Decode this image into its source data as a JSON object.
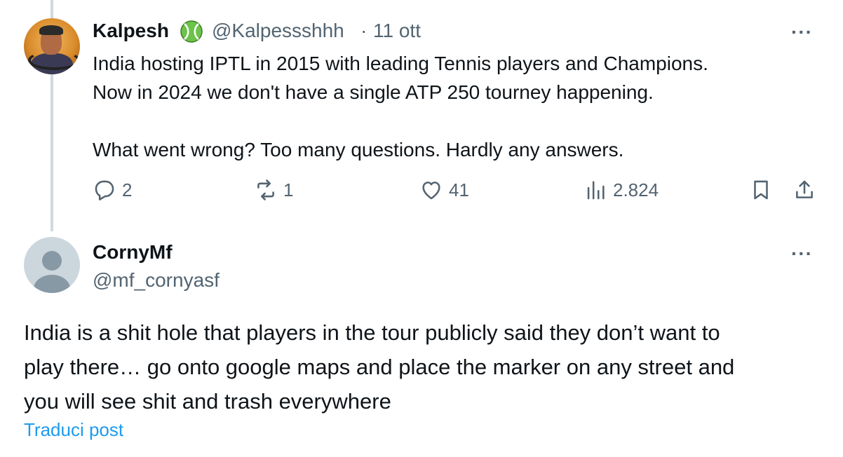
{
  "tweet": {
    "author_name": "Kalpesh",
    "handle": "@Kalpessshhh",
    "separator": "·",
    "date": "11 ott",
    "more_label": "···",
    "lines": [
      "India hosting IPTL in 2015 with leading Tennis players and Champions.",
      "Now in 2024 we don't have a single ATP 250 tourney happening.",
      "What went wrong? Too many questions. Hardly any answers."
    ],
    "actions": {
      "replies": "2",
      "reposts": "1",
      "likes": "41",
      "views": "2.824"
    },
    "icons": [
      "tennis-ball-icon",
      "reply-icon",
      "repost-icon",
      "like-icon",
      "views-icon",
      "bookmark-icon",
      "share-icon"
    ]
  },
  "reply": {
    "author_name": "CornyMf",
    "handle": "@mf_cornyasf",
    "more_label": "···",
    "lines": [
      "India is a shit hole that players in the tour publicly said they don’t want to",
      "play there… go onto google maps and place the marker on any street and",
      "you will see shit and trash everywhere"
    ],
    "translate_label": "Traduci post"
  },
  "colors": {
    "text": "#0f1419",
    "secondary": "#536471",
    "link": "#1d9bf0",
    "thread_line": "#cfd9de",
    "badge_green": "#6cc24a"
  }
}
